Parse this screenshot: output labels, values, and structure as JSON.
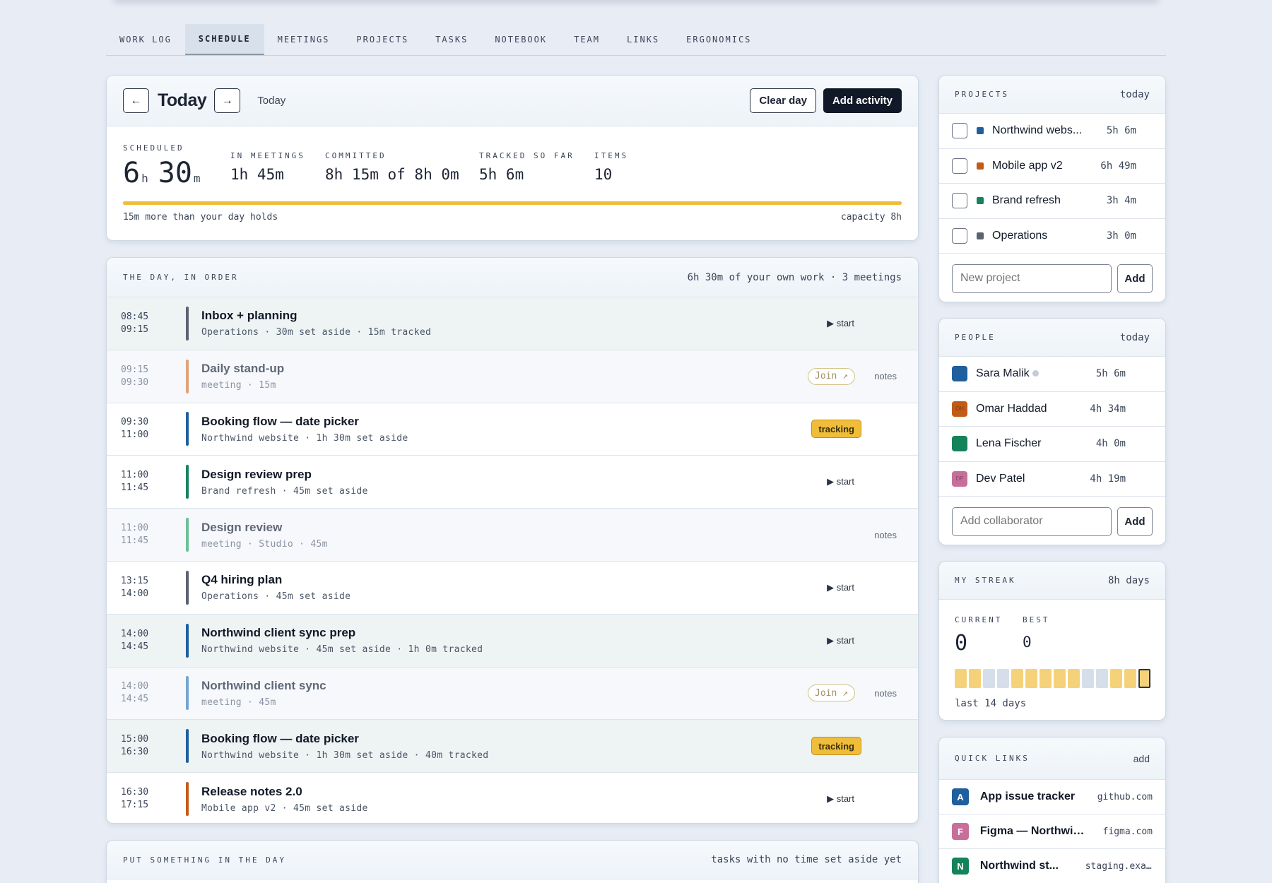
{
  "tabs": [
    "WORK LOG",
    "SCHEDULE",
    "MEETINGS",
    "PROJECTS",
    "TASKS",
    "NOTEBOOK",
    "TEAM",
    "LINKS",
    "ERGONOMICS"
  ],
  "active_tab": "SCHEDULE",
  "today": {
    "prev_icon": "arrow-left",
    "next_icon": "arrow-right",
    "title": "Today",
    "subtitle": "Today",
    "clear_label": "Clear day",
    "add_label": "Add activity",
    "scheduled_label": "SCHEDULED",
    "scheduled_hours": "6",
    "scheduled_h_unit": "h",
    "scheduled_minutes": "30",
    "scheduled_m_unit": "m",
    "meetings_label": "IN MEETINGS",
    "meetings_value": "1h 45m",
    "committed_label": "COMMITTED",
    "committed_value": "8h 15m of 8h 0m",
    "tracked_label": "TRACKED SO FAR",
    "tracked_value": "5h 6m",
    "items_label": "ITEMS",
    "items_value": "10",
    "progress_fraction": 1.0,
    "over_note": "15m more than your day holds",
    "capacity": "capacity 8h"
  },
  "day": {
    "heading": "THE DAY, IN ORDER",
    "summary": "6h 30m of your own work · 3 meetings",
    "rows": [
      {
        "start": "08:45",
        "end": "09:15",
        "title": "Inbox + planning",
        "sub": "Operations · 30m set aside · 15m tracked",
        "kind": "task",
        "action": "▶ start",
        "color": "#5b6270",
        "shaded": true
      },
      {
        "start": "09:15",
        "end": "09:30",
        "title": "Daily stand-up",
        "sub": "meeting · 15m",
        "kind": "meeting",
        "join": "Join ↗",
        "notes": "notes",
        "color": "#e0a377"
      },
      {
        "start": "09:30",
        "end": "11:00",
        "title": "Booking flow — date picker",
        "sub": "Northwind website · 1h 30m set aside",
        "kind": "tracking",
        "badge": "tracking",
        "color": "#1f5f9e"
      },
      {
        "start": "11:00",
        "end": "11:45",
        "title": "Design review prep",
        "sub": "Brand refresh · 45m set aside",
        "kind": "task",
        "action": "▶ start",
        "color": "#15835a"
      },
      {
        "start": "11:00",
        "end": "11:45",
        "title": "Design review",
        "sub": "meeting · Studio · 45m",
        "kind": "meeting",
        "notes": "notes",
        "color": "#6cbf98"
      },
      {
        "start": "13:15",
        "end": "14:00",
        "title": "Q4 hiring plan",
        "sub": "Operations · 45m set aside",
        "kind": "task",
        "action": "▶ start",
        "color": "#5b6270"
      },
      {
        "start": "14:00",
        "end": "14:45",
        "title": "Northwind client sync prep",
        "sub": "Northwind website · 45m set aside · 1h 0m tracked",
        "kind": "task",
        "action": "▶ start",
        "color": "#1f5f9e",
        "shaded": true
      },
      {
        "start": "14:00",
        "end": "14:45",
        "title": "Northwind client sync",
        "sub": "meeting · 45m",
        "kind": "meeting",
        "join": "Join ↗",
        "notes": "notes",
        "color": "#75a6cf"
      },
      {
        "start": "15:00",
        "end": "16:30",
        "title": "Booking flow — date picker",
        "sub": "Northwind website · 1h 30m set aside · 40m tracked",
        "kind": "tracking",
        "badge": "tracking",
        "color": "#1f5f9e",
        "shaded": true
      },
      {
        "start": "16:30",
        "end": "17:15",
        "title": "Release notes 2.0",
        "sub": "Mobile app v2 · 45m set aside",
        "kind": "task",
        "action": "▶ start",
        "color": "#c25a18"
      }
    ]
  },
  "put": {
    "heading": "PUT SOMETHING IN THE DAY",
    "summary": "tasks with no time set aside yet"
  },
  "projects": {
    "heading": "PROJECTS",
    "meta": "today",
    "items": [
      {
        "name": "Northwind webs...",
        "hours": "5h 6m",
        "color": "#1f5f9e"
      },
      {
        "name": "Mobile app v2",
        "hours": "6h 49m",
        "color": "#c25a18"
      },
      {
        "name": "Brand refresh",
        "hours": "3h 4m",
        "color": "#15835a"
      },
      {
        "name": "Operations",
        "hours": "3h 0m",
        "color": "#5b6270"
      }
    ],
    "placeholder": "New project",
    "add_label": "Add"
  },
  "people": {
    "heading": "PEOPLE",
    "meta": "today",
    "items": [
      {
        "name": "Sara Malik",
        "hours": "5h 6m",
        "color": "#1f5f9e",
        "initials": "",
        "online_dot": true
      },
      {
        "name": "Omar Haddad",
        "hours": "4h 34m",
        "color": "#c25a18",
        "initials": "OH"
      },
      {
        "name": "Lena Fischer",
        "hours": "4h 0m",
        "color": "#15835a",
        "initials": ""
      },
      {
        "name": "Dev Patel",
        "hours": "4h 19m",
        "color": "#c86e9b",
        "initials": "DP"
      }
    ],
    "placeholder": "Add collaborator",
    "add_label": "Add"
  },
  "streak": {
    "heading": "MY STREAK",
    "meta": "8h days",
    "current_label": "CURRENT",
    "best_label": "BEST",
    "current": "0",
    "best": "0",
    "days": [
      "on",
      "on",
      "off",
      "off",
      "on",
      "on",
      "on",
      "on",
      "on",
      "off",
      "off",
      "on",
      "on",
      "today"
    ],
    "caption": "last 14 days"
  },
  "links": {
    "heading": "QUICK LINKS",
    "add_label": "add",
    "items": [
      {
        "letter": "A",
        "name": "App issue tracker",
        "host": "github.com",
        "color": "#1f5f9e"
      },
      {
        "letter": "F",
        "name": "Figma — Northwind",
        "host": "figma.com",
        "color": "#c86e9b"
      },
      {
        "letter": "N",
        "name": "Northwind st...",
        "host": "staging.exa...",
        "color": "#15835a"
      }
    ]
  }
}
